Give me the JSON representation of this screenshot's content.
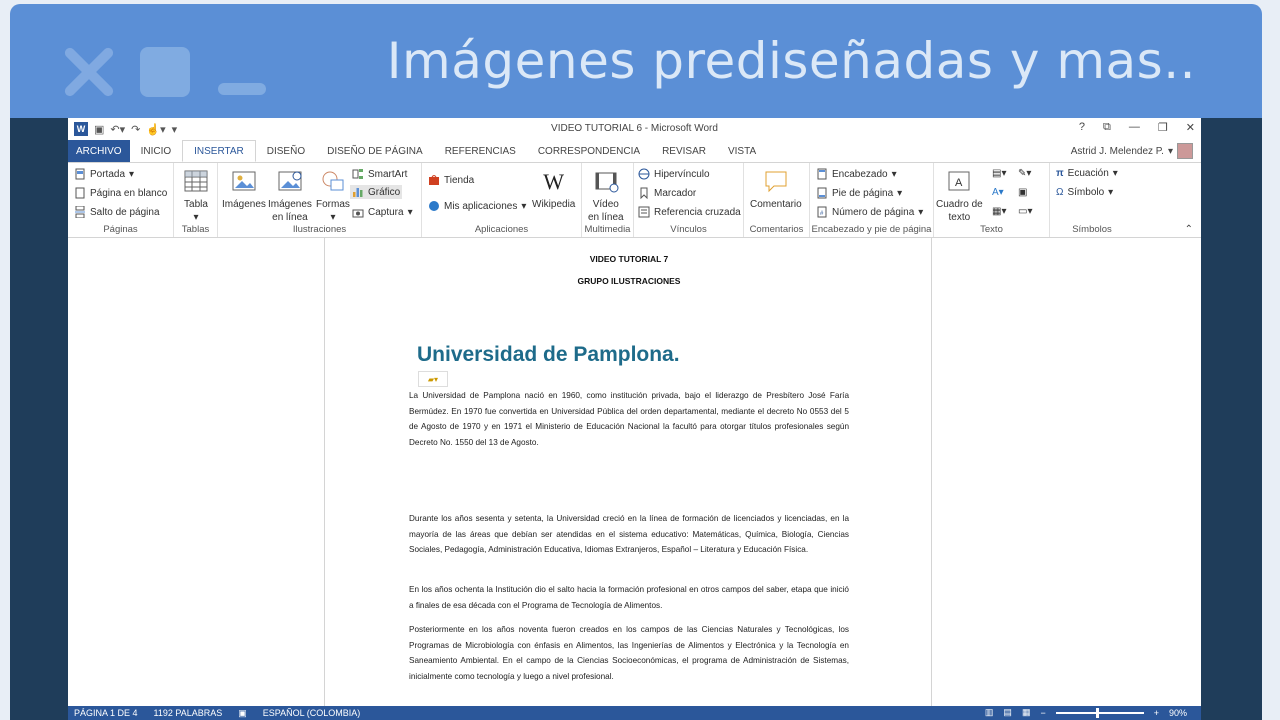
{
  "banner": {
    "title": "Imágenes prediseñadas y mas.."
  },
  "window": {
    "title": "VIDEO TUTORIAL 6 - Microsoft Word",
    "help": "?",
    "logo_letter": "W"
  },
  "tabs": {
    "file": "ARCHIVO",
    "items": [
      "INICIO",
      "INSERTAR",
      "DISEÑO",
      "DISEÑO DE PÁGINA",
      "REFERENCIAS",
      "CORRESPONDENCIA",
      "REVISAR",
      "VISTA"
    ],
    "active": "INSERTAR"
  },
  "user": {
    "name": "Astrid J. Melendez P."
  },
  "ribbon": {
    "paginas": {
      "label": "Páginas",
      "portada": "Portada",
      "pagina_en_blanco": "Página en blanco",
      "salto_de_pagina": "Salto de página"
    },
    "tablas": {
      "label": "Tablas",
      "tabla": "Tabla"
    },
    "ilustraciones": {
      "label": "Ilustraciones",
      "imagenes": "Imágenes",
      "imagenes_en_linea_1": "Imágenes",
      "imagenes_en_linea_2": "en línea",
      "formas": "Formas",
      "smartart": "SmartArt",
      "grafico": "Gráfico",
      "captura": "Captura"
    },
    "aplicaciones": {
      "label": "Aplicaciones",
      "tienda": "Tienda",
      "mis_aplicaciones": "Mis aplicaciones",
      "wikipedia": "Wikipedia"
    },
    "multimedia": {
      "label": "Multimedia",
      "video_1": "Vídeo",
      "video_2": "en línea"
    },
    "vinculos": {
      "label": "Vínculos",
      "hipervinculo": "Hipervínculo",
      "marcador": "Marcador",
      "referencia_cruzada": "Referencia cruzada"
    },
    "comentarios": {
      "label": "Comentarios",
      "comentario": "Comentario"
    },
    "encabezado": {
      "label": "Encabezado y pie de página",
      "encabezado": "Encabezado",
      "pie_de_pagina": "Pie de página",
      "numero_de_pagina": "Número de página"
    },
    "texto": {
      "label": "Texto",
      "cuadro_1": "Cuadro de",
      "cuadro_2": "texto"
    },
    "simbolos": {
      "label": "Símbolos",
      "ecuacion": "Ecuación",
      "simbolo": "Símbolo"
    }
  },
  "document": {
    "heading1": "VIDEO TUTORIAL 7",
    "heading2": "GRUPO ILUSTRACIONES",
    "title": "Universidad de Pamplona.",
    "p1": "La Universidad de Pamplona nació en 1960, como institución privada, bajo el liderazgo de Presbítero José Faría Bermúdez. En 1970 fue convertida en Universidad Pública del orden departamental, mediante el decreto No 0553 del 5 de Agosto de 1970 y en 1971 el Ministerio de Educación Nacional la facultó para otorgar títulos profesionales según Decreto No. 1550 del 13 de Agosto.",
    "p2": "Durante los años sesenta y setenta, la Universidad creció en la línea de formación de licenciados y licenciadas, en la mayoría de las áreas que debían ser atendidas en el sistema educativo: Matemáticas, Química, Biología, Ciencias Sociales, Pedagogía, Administración Educativa, Idiomas Extranjeros, Español – Literatura y Educación Física.",
    "p3": "En los años ochenta la Institución dio el salto hacia la formación profesional en otros campos del saber, etapa que inició a finales de esa década con el Programa de Tecnología de Alimentos.",
    "p4": "Posteriormente en los años noventa fueron creados en los campos de las Ciencias Naturales y Tecnológicas, los Programas de Microbiología con énfasis en Alimentos, las Ingenierías de Alimentos y Electrónica y la Tecnología en Saneamiento Ambiental. En el campo de la Ciencias Socioeconómicas, el programa de Administración de Sistemas, inicialmente como tecnología y luego a nivel profesional."
  },
  "status": {
    "page": "PÁGINA 1 DE 4",
    "words": "1192 PALABRAS",
    "language": "ESPAÑOL (COLOMBIA)",
    "zoom": "90%",
    "zoom_minus": "−",
    "zoom_plus": "+"
  }
}
